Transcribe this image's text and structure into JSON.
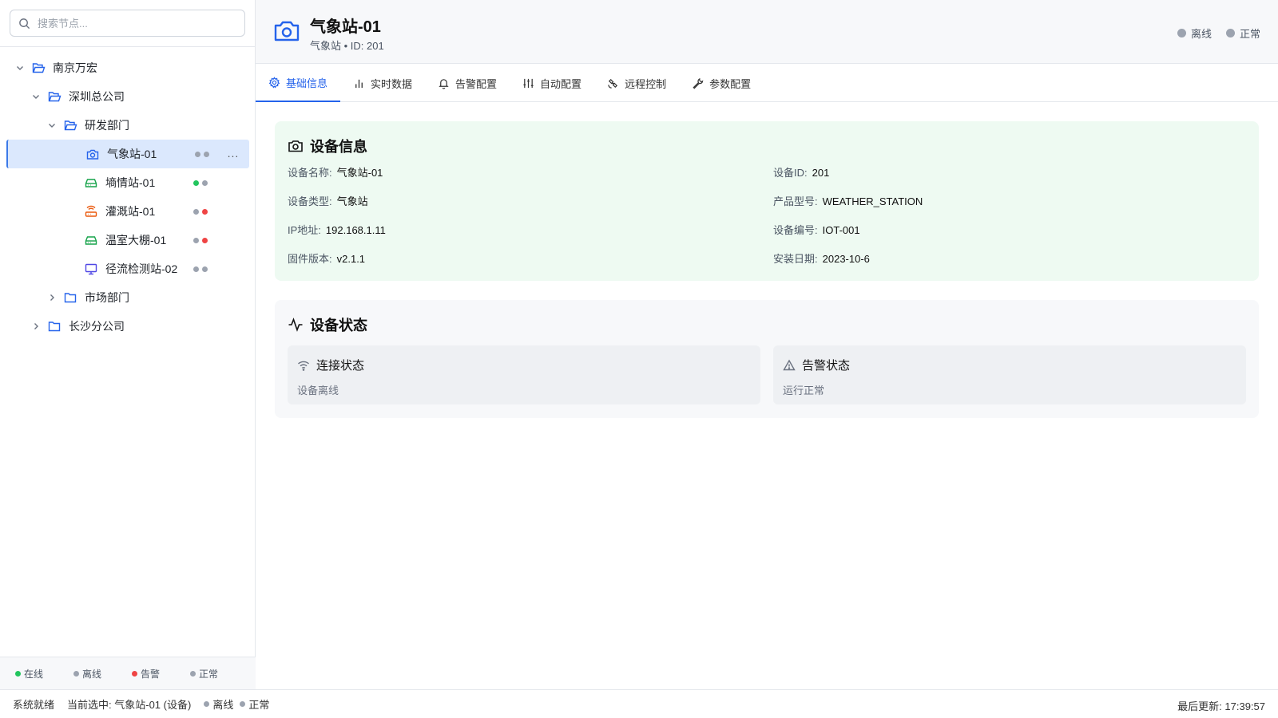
{
  "search": {
    "placeholder": "搜索节点..."
  },
  "tree": {
    "root": "南京万宏",
    "branch1": "深圳总公司",
    "dept1": "研发部门",
    "devices": [
      {
        "label": "气象站-01",
        "icon": "camera-icon",
        "status": [
          "gray",
          "gray"
        ]
      },
      {
        "label": "墒情站-01",
        "icon": "hard-drive-icon",
        "status": [
          "green",
          "gray"
        ]
      },
      {
        "label": "灌溉站-01",
        "icon": "router-icon",
        "status": [
          "gray",
          "red"
        ]
      },
      {
        "label": "温室大棚-01",
        "icon": "hard-drive-icon",
        "status": [
          "gray",
          "red"
        ]
      },
      {
        "label": "径流检测站-02",
        "icon": "monitor-icon",
        "status": [
          "gray",
          "gray"
        ]
      }
    ],
    "dept2": "市场部门",
    "branch2": "长沙分公司",
    "more": "..."
  },
  "legend": {
    "online": "在线",
    "offline": "离线",
    "alarm": "告警",
    "normal": "正常"
  },
  "header": {
    "title": "气象站-01",
    "subtitle": "气象站 • ID: 201",
    "status_offline": "离线",
    "status_normal": "正常"
  },
  "tabs": [
    "基础信息",
    "实时数据",
    "告警配置",
    "自动配置",
    "远程控制",
    "参数配置"
  ],
  "device_info": {
    "title": "设备信息",
    "name_label": "设备名称:",
    "name_value": "气象站-01",
    "id_label": "设备ID:",
    "id_value": "201",
    "type_label": "设备类型:",
    "type_value": "气象站",
    "model_label": "产品型号:",
    "model_value": "WEATHER_STATION",
    "ip_label": "IP地址:",
    "ip_value": "192.168.1.11",
    "serial_label": "设备编号:",
    "serial_value": "IOT-001",
    "fw_label": "固件版本:",
    "fw_value": "v2.1.1",
    "date_label": "安装日期:",
    "date_value": "2023-10-6"
  },
  "device_status": {
    "title": "设备状态",
    "conn_title": "连接状态",
    "conn_value": "设备离线",
    "alarm_title": "告警状态",
    "alarm_value": "运行正常"
  },
  "statusbar": {
    "ready": "系统就绪",
    "selected": "当前选中: 气象站-01 (设备)",
    "offline": "离线",
    "normal": "正常",
    "updated": "最后更新: 17:39:57"
  },
  "colors": {
    "accent": "#2563eb",
    "online": "#22c55e",
    "alarm": "#ef4444",
    "neutral": "#9ca3af"
  }
}
